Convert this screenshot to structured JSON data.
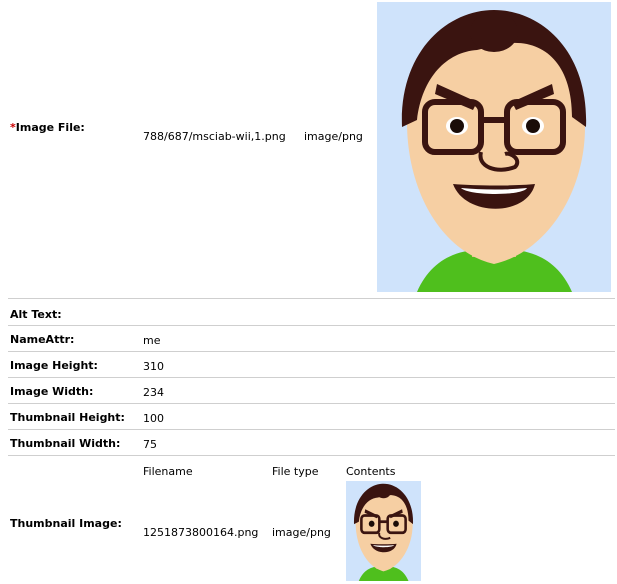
{
  "image_file": {
    "required_mark": "*",
    "label": "Image File:",
    "path": "788/687/msciab-wii,1.png",
    "mime": "image/png",
    "preview_name": "large-avatar-image"
  },
  "rows": [
    {
      "label": "Alt Text:",
      "value": ""
    },
    {
      "label": "NameAttr:",
      "value": "me"
    },
    {
      "label": "Image Height:",
      "value": "310"
    },
    {
      "label": "Image Width:",
      "value": "234"
    },
    {
      "label": "Thumbnail Height:",
      "value": "100"
    },
    {
      "label": "Thumbnail Width:",
      "value": "75"
    }
  ],
  "thumbnail": {
    "label": "Thumbnail Image:",
    "headers": {
      "filename": "Filename",
      "filetype": "File type",
      "contents": "Contents"
    },
    "filename": "1251873800164.png",
    "filetype": "image/png"
  },
  "colors": {
    "required": "#cc0000",
    "rule": "#cfcfcf",
    "avatar_bg": "#cfe3fb",
    "hair": "#3a1410",
    "skin": "#f6cfa3",
    "shirt": "#4fbf1d"
  }
}
